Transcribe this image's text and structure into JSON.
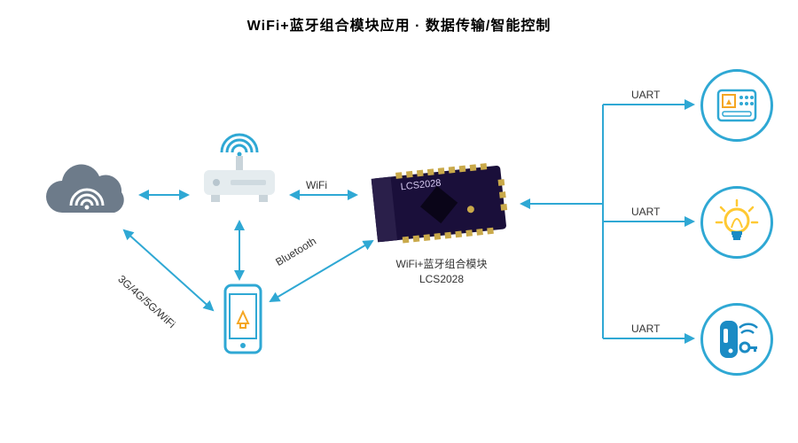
{
  "title": "WiFi+蓝牙组合模块应用 · 数据传输/智能控制",
  "module": {
    "name_line1": "WiFi+蓝牙组合模块",
    "name_line2": "LCS2028",
    "chip_label": "LCS2028"
  },
  "links": {
    "cloud_router": "",
    "cloud_phone": "3G/4G/5G/WiFi",
    "router_module": "WiFi",
    "phone_module": "Bluetooth",
    "module_dev1": "UART",
    "module_dev2": "UART",
    "module_dev3": "UART"
  },
  "devices": {
    "dev1": "control-panel",
    "dev2": "lightbulb",
    "dev3": "smart-lock"
  },
  "colors": {
    "accent": "#2fa8d4",
    "cloud_fill": "#6d7b8a",
    "router_fill": "#e5ecef",
    "bulb": "#ffc933",
    "lock": "#1b8bc4"
  }
}
